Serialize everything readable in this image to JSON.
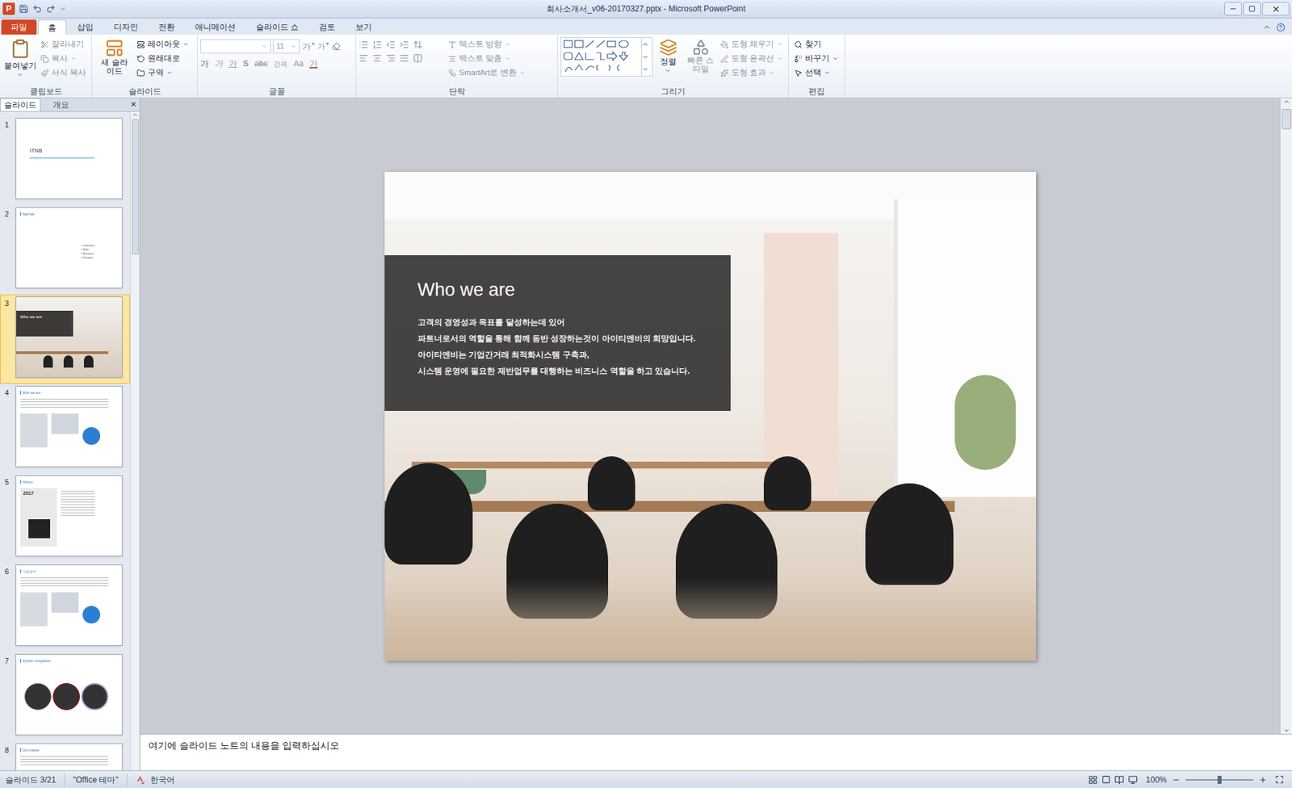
{
  "window": {
    "title": "회사소개서_v06-20170327.pptx - Microsoft PowerPoint",
    "app_icon": "P"
  },
  "ribbon": {
    "tabs": [
      {
        "label": "파일",
        "selected": false,
        "kind": "file"
      },
      {
        "label": "홈",
        "selected": true,
        "kind": "tab"
      },
      {
        "label": "삽입",
        "selected": false,
        "kind": "tab"
      },
      {
        "label": "디자인",
        "selected": false,
        "kind": "tab"
      },
      {
        "label": "전환",
        "selected": false,
        "kind": "tab"
      },
      {
        "label": "애니메이션",
        "selected": false,
        "kind": "tab"
      },
      {
        "label": "슬라이드 쇼",
        "selected": false,
        "kind": "tab"
      },
      {
        "label": "검토",
        "selected": false,
        "kind": "tab"
      },
      {
        "label": "보기",
        "selected": false,
        "kind": "tab"
      }
    ],
    "clipboard": {
      "label": "클립보드",
      "paste": {
        "label": "붙여넣기",
        "disabled": false
      },
      "items": [
        {
          "label": "잘라내기",
          "disabled": true,
          "menu": false
        },
        {
          "label": "복사",
          "disabled": true,
          "menu": true
        },
        {
          "label": "서식 복사",
          "disabled": true,
          "menu": false
        }
      ]
    },
    "slides": {
      "label": "슬라이드",
      "new_slide": {
        "label": "새 슬라이드",
        "disabled": false
      },
      "items": [
        {
          "label": "레이아웃",
          "disabled": false,
          "menu": true
        },
        {
          "label": "원래대로",
          "disabled": false,
          "menu": false
        },
        {
          "label": "구역",
          "disabled": false,
          "menu": true
        }
      ]
    },
    "font": {
      "label": "글꼴",
      "font_name": "",
      "font_size": "11",
      "disabled": true,
      "size_buttons": [
        {
          "label": "가",
          "kind": "grow"
        },
        {
          "label": "가",
          "kind": "shrink"
        }
      ],
      "buttons": [
        {
          "label": "가",
          "kind": "bold"
        },
        {
          "label": "가",
          "kind": "italic"
        },
        {
          "label": "가",
          "kind": "underline"
        },
        {
          "label": "S",
          "kind": "shadow"
        },
        {
          "label": "abc",
          "kind": "strike"
        },
        {
          "label": "간격",
          "kind": "spacing"
        },
        {
          "label": "Aa",
          "kind": "case"
        },
        {
          "label": "가",
          "kind": "color"
        }
      ]
    },
    "paragraph": {
      "label": "단락",
      "items": [
        {
          "label": "텍스트 방향",
          "disabled": true,
          "menu": true
        },
        {
          "label": "텍스트 맞춤",
          "disabled": true,
          "menu": true
        },
        {
          "label": "SmartArt로 변환",
          "disabled": true,
          "menu": true
        }
      ]
    },
    "drawing": {
      "label": "그리기",
      "arrange": {
        "label": "정렬",
        "disabled": false
      },
      "quick_styles": {
        "label": "빠른 스타일",
        "disabled": true
      },
      "items": [
        {
          "label": "도형 채우기",
          "disabled": true,
          "menu": true
        },
        {
          "label": "도형 윤곽선",
          "disabled": true,
          "menu": true
        },
        {
          "label": "도형 효과",
          "disabled": true,
          "menu": true
        }
      ]
    },
    "editing": {
      "label": "편집",
      "items": [
        {
          "label": "찾기",
          "disabled": false,
          "menu": false
        },
        {
          "label": "바꾸기",
          "disabled": false,
          "menu": true
        },
        {
          "label": "선택",
          "disabled": false,
          "menu": true
        }
      ]
    }
  },
  "outline_pane": {
    "tabs": [
      {
        "label": "슬라이드",
        "selected": true
      },
      {
        "label": "개요",
        "selected": false
      }
    ],
    "close": "×"
  },
  "thumbnails": [
    {
      "number": "1",
      "title": "ITNB",
      "kind": "cover",
      "selected": false,
      "items": []
    },
    {
      "number": "2",
      "title": "Agenda",
      "kind": "agenda",
      "selected": false,
      "items": [
        "Overview",
        "R&D",
        "Business",
        "Portfolio"
      ]
    },
    {
      "number": "3",
      "title": "Who we are",
      "kind": "photo",
      "selected": true,
      "items": []
    },
    {
      "number": "4",
      "title": "Who we are",
      "kind": "content",
      "selected": false,
      "items": []
    },
    {
      "number": "5",
      "title": "History",
      "kind": "history",
      "selected": false,
      "items": [
        "2017"
      ]
    },
    {
      "number": "6",
      "title": "사업영역",
      "kind": "content",
      "selected": false,
      "items": []
    },
    {
      "number": "7",
      "title": "System Integration",
      "kind": "diagram",
      "selected": false,
      "items": []
    },
    {
      "number": "8",
      "title": "Our market",
      "kind": "content",
      "selected": false,
      "items": []
    }
  ],
  "slide": {
    "heading": "Who we are",
    "lines": [
      "고객의 경영성과 목표를 달성하는데 있어",
      "파트너로서의 역할을 통해 함께 동반 성장하는것이 아이티엔비의 희망입니다.",
      "아이티엔비는 기업간거래 최적화시스템 구축과,",
      "시스템 운영에 필요한 제반업무를 대행하는 비즈니스 역할을 하고 있습니다."
    ]
  },
  "notes": {
    "placeholder": "여기에 슬라이드 노트의 내용을 입력하십시오"
  },
  "status_bar": {
    "slide": "슬라이드 3/21",
    "theme": "\"Office 테마\"",
    "language": "한국어",
    "zoom": "100%",
    "zoom_level": 0.5
  }
}
